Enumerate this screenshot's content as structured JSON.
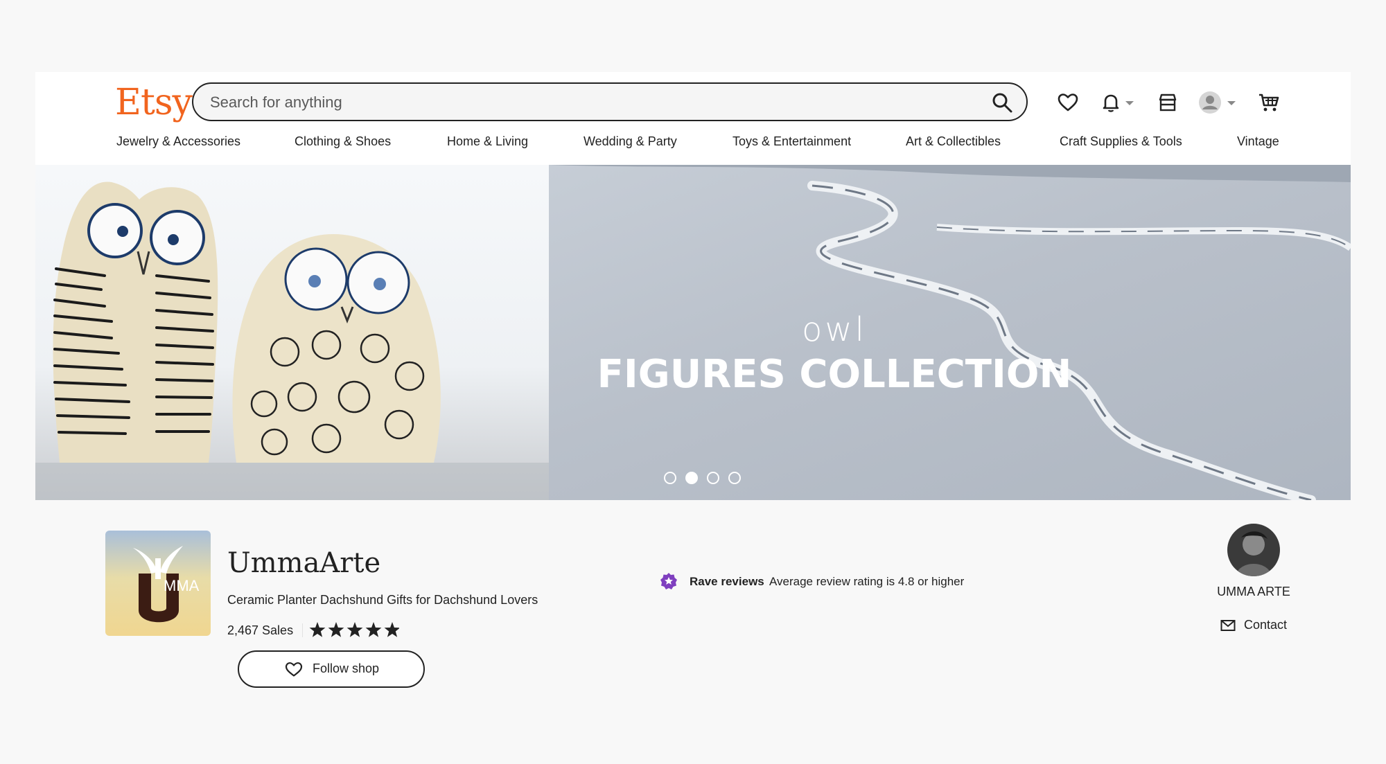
{
  "header": {
    "logo": "Etsy",
    "search": {
      "placeholder": "Search for anything",
      "value": ""
    },
    "icons": [
      "favorites-heart-icon",
      "notifications-bell-icon",
      "shop-manager-icon",
      "account-avatar-icon",
      "cart-icon"
    ]
  },
  "nav": {
    "items": [
      "Jewelry & Accessories",
      "Clothing & Shoes",
      "Home & Living",
      "Wedding & Party",
      "Toys & Entertainment",
      "Art & Collectibles",
      "Craft Supplies & Tools",
      "Vintage"
    ]
  },
  "banner": {
    "subtitle": "owl",
    "title": "FIGURES COLLECTION",
    "slide_count": 4,
    "active_slide": 2
  },
  "shop": {
    "logo_text": "MMA",
    "name": "UmmaArte",
    "tagline": "Ceramic Planter Dachshund Gifts for Dachshund Lovers",
    "sales": "2,467 Sales",
    "rating": 5,
    "rave_title": "Rave reviews",
    "rave_desc": "Average review rating is 4.8 or higher",
    "owner_name": "UMMA ARTE",
    "contact_label": "Contact",
    "follow_label": "Follow shop"
  },
  "colors": {
    "brand": "#f1641e",
    "rave_badge": "#7f3fbf"
  }
}
